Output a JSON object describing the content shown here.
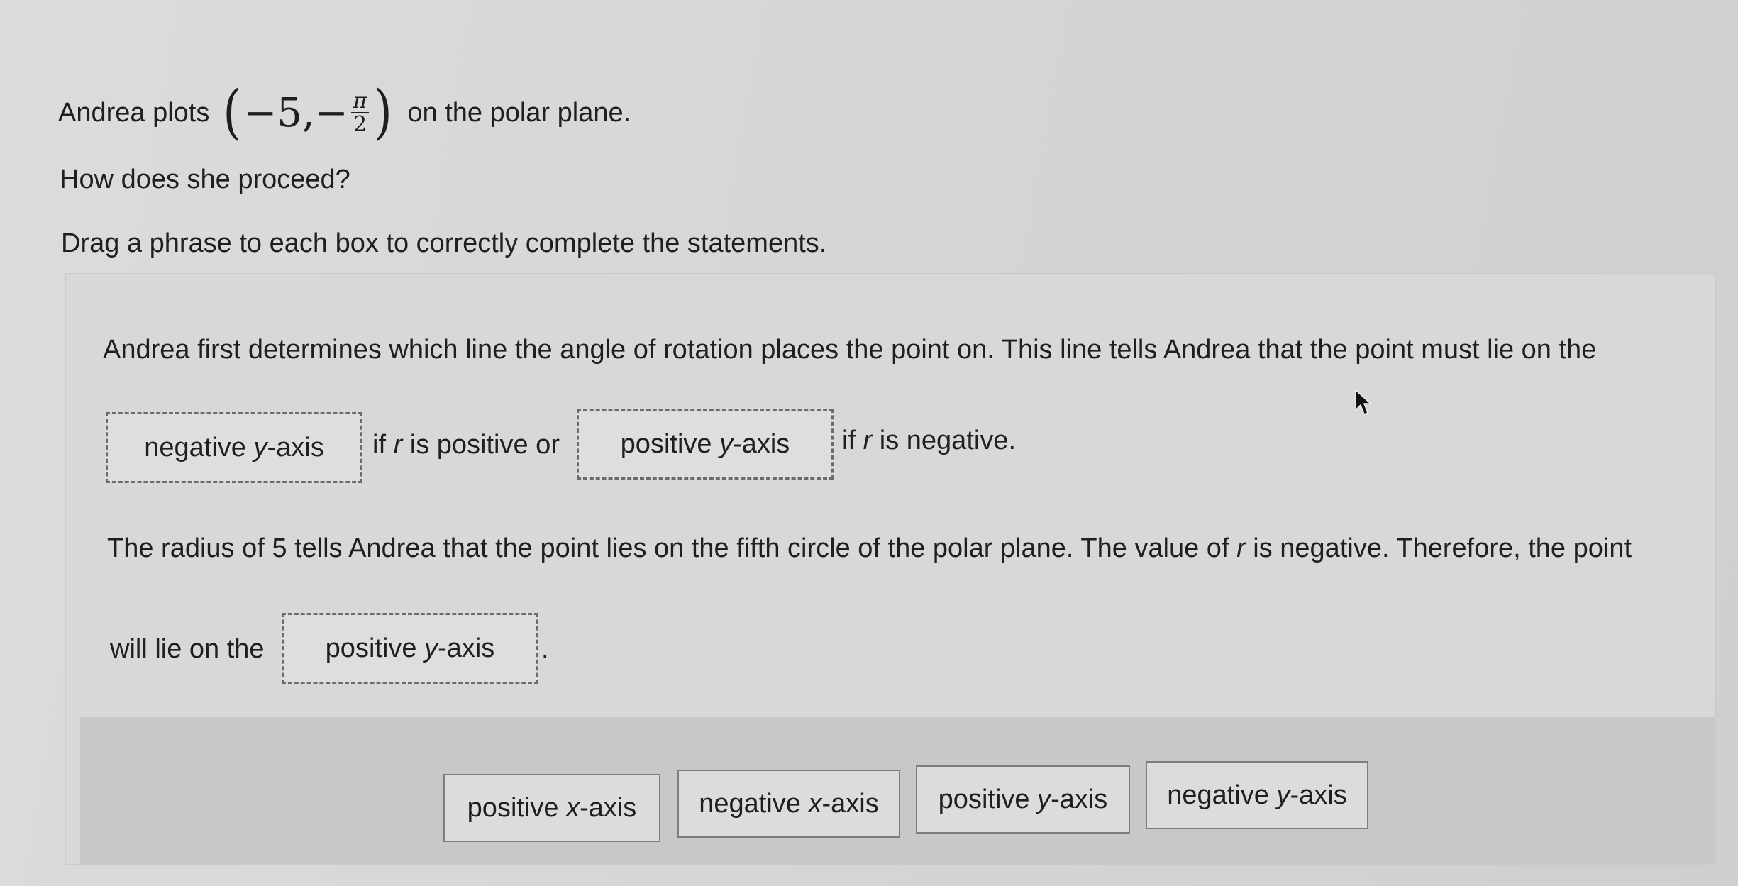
{
  "question": {
    "prefix": "Andrea plots",
    "math": {
      "r": "−5,",
      "sign": "−",
      "num": "π",
      "den": "2"
    },
    "suffix": "on the polar plane.",
    "prompt": "How does she proceed?",
    "instruction": "Drag a phrase to each box to correctly complete the statements."
  },
  "statement1": {
    "text": "Andrea first determines which line the angle of rotation places the point on. This line tells Andrea that the point must lie on the",
    "box1": {
      "pre": "negative",
      "var": "y",
      "post": "-axis"
    },
    "mid_a": "if",
    "mid_var": "r",
    "mid_b": "is positive or",
    "box2": {
      "pre": "positive",
      "var": "y",
      "post": "-axis"
    },
    "end_a": "if",
    "end_var": "r",
    "end_b": "is negative."
  },
  "statement2": {
    "text_a": "The radius of 5 tells Andrea that the point lies on the fifth circle of the polar plane. The value of",
    "text_var": "r",
    "text_b": "is negative. Therefore, the point",
    "lead": "will lie on the",
    "box3": {
      "pre": "positive",
      "var": "y",
      "post": "-axis"
    },
    "end": "."
  },
  "bank": [
    {
      "pre": "positive",
      "var": "x",
      "post": "-axis"
    },
    {
      "pre": "negative",
      "var": "x",
      "post": "-axis"
    },
    {
      "pre": "positive",
      "var": "y",
      "post": "-axis"
    },
    {
      "pre": "negative",
      "var": "y",
      "post": "-axis"
    }
  ]
}
